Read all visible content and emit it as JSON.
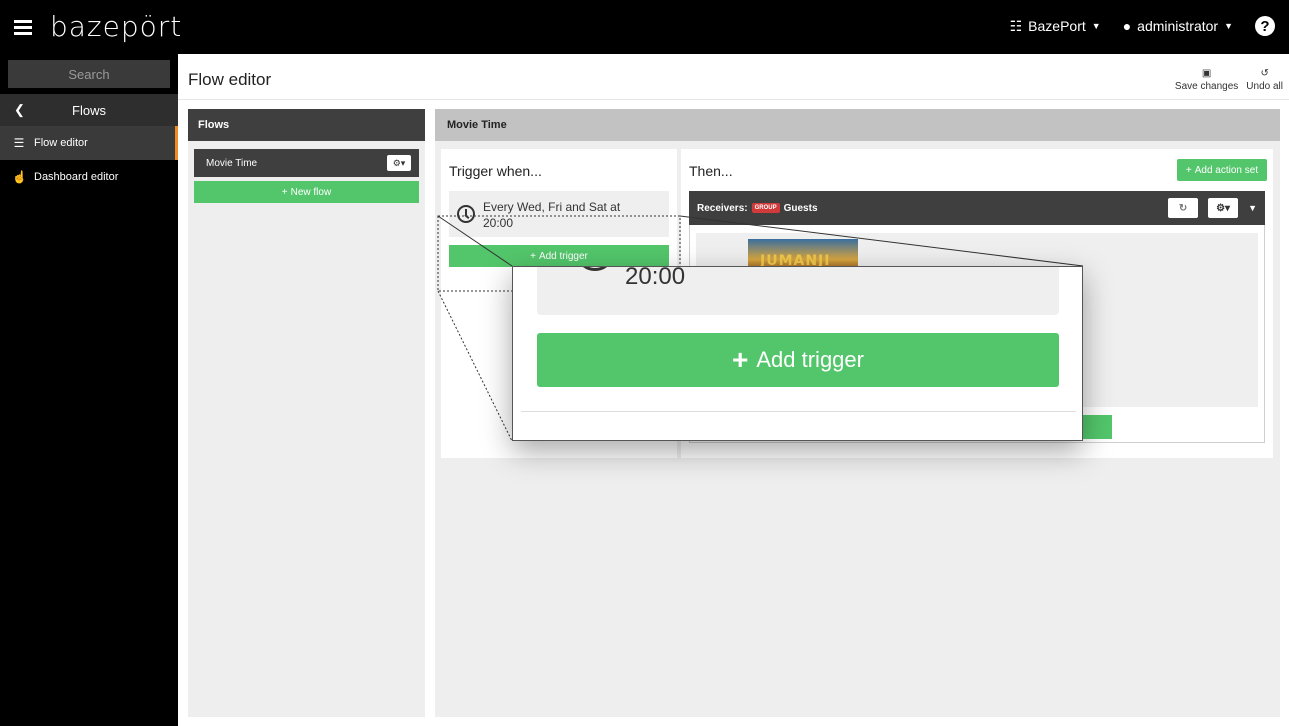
{
  "topbar": {
    "logo": "bazepört",
    "org_label": "BazePort",
    "user_label": "administrator",
    "help_label": "?"
  },
  "sidebar": {
    "search_placeholder": "Search",
    "back_label": "Flows",
    "items": [
      {
        "label": "Flow editor",
        "icon": "list-icon",
        "active": true
      },
      {
        "label": "Dashboard editor",
        "icon": "hand-pointer-icon",
        "active": false
      }
    ]
  },
  "page": {
    "title": "Flow editor",
    "save_label": "Save changes",
    "undo_label": "Undo all"
  },
  "flows_panel": {
    "header": "Flows",
    "items": [
      {
        "label": "Movie Time"
      }
    ],
    "new_flow_label": "New flow"
  },
  "editor": {
    "flow_name": "Movie Time",
    "trigger_title": "Trigger when...",
    "trigger_text": "Every Wed, Fri and Sat at 20:00",
    "add_trigger_label": "Add trigger",
    "then_title": "Then...",
    "add_action_set_label": "Add action set",
    "receivers_label": "Receivers:",
    "group_badge": "GROUP",
    "receivers_value": "Guests",
    "poster_text": "JUMANJI"
  },
  "zoom": {
    "time_text": "20:00",
    "add_trigger_label": "Add trigger"
  },
  "colors": {
    "green": "#53c66b",
    "accent_orange": "#f08a24",
    "dark_header": "#3f3f3f",
    "group_badge": "#d13a3a"
  }
}
